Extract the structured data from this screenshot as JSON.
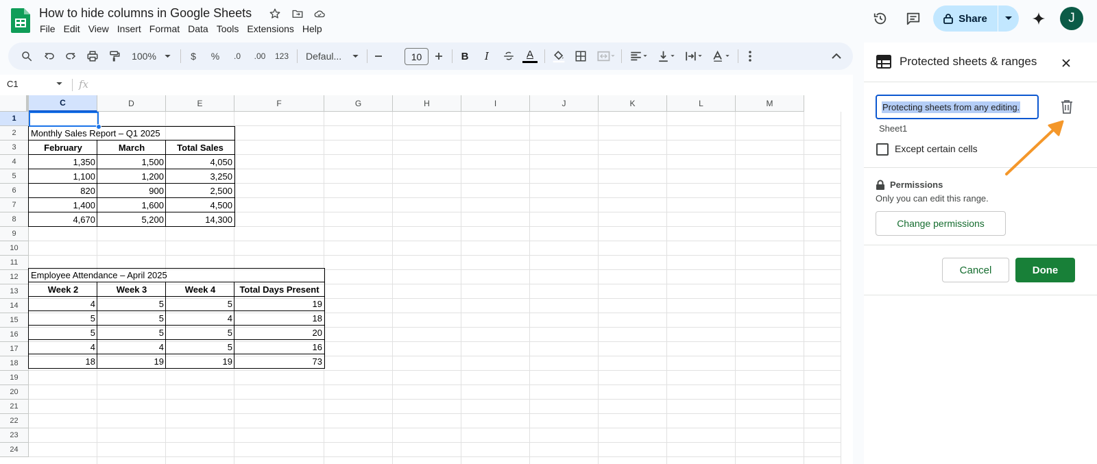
{
  "app": {
    "doc_title": "How to hide columns in Google Sheets",
    "menu": [
      "File",
      "Edit",
      "View",
      "Insert",
      "Format",
      "Data",
      "Tools",
      "Extensions",
      "Help"
    ],
    "share_label": "Share",
    "avatar_initial": "J",
    "accent_color": "#0b57d0",
    "share_bg": "#c2e7ff"
  },
  "toolbar": {
    "zoom": "100%",
    "currency": "$",
    "percent": "%",
    "dec_decrease": ".0",
    "dec_increase": ".00",
    "number_format": "123",
    "font": "Defaul...",
    "font_size": "10",
    "bold": "B",
    "italic": "I",
    "text_color_letter": "A"
  },
  "formula_bar": {
    "name_box": "C1",
    "fx": "fx"
  },
  "grid": {
    "columns": [
      "C",
      "D",
      "E",
      "F",
      "G",
      "H",
      "I",
      "J",
      "K",
      "L",
      "M"
    ],
    "rows": [
      "1",
      "2",
      "3",
      "4",
      "5",
      "6",
      "7",
      "8",
      "9",
      "10",
      "11",
      "12",
      "13",
      "14",
      "15",
      "16",
      "17",
      "18",
      "19",
      "20",
      "21",
      "22",
      "23",
      "24"
    ],
    "selected_column": "C",
    "selected_row": "1"
  },
  "sales_table": {
    "title": "Monthly Sales Report – Q1 2025",
    "headers": [
      "February",
      "March",
      "Total Sales"
    ],
    "rows": [
      [
        "1,350",
        "1,500",
        "4,050"
      ],
      [
        "1,100",
        "1,200",
        "3,250"
      ],
      [
        "820",
        "900",
        "2,500"
      ],
      [
        "1,400",
        "1,600",
        "4,500"
      ],
      [
        "4,670",
        "5,200",
        "14,300"
      ]
    ]
  },
  "attendance_table": {
    "title": "Employee Attendance – April 2025",
    "headers": [
      "Week 2",
      "Week 3",
      "Week 4",
      "Total Days Present"
    ],
    "rows": [
      [
        "4",
        "5",
        "5",
        "19"
      ],
      [
        "5",
        "5",
        "4",
        "18"
      ],
      [
        "5",
        "5",
        "5",
        "20"
      ],
      [
        "4",
        "4",
        "5",
        "16"
      ],
      [
        "18",
        "19",
        "19",
        "73"
      ]
    ]
  },
  "panel": {
    "title": "Protected sheets & ranges",
    "description_value": "Protecting sheets from any editing.",
    "sheet_name": "Sheet1",
    "except_label": "Except certain cells",
    "permissions_title": "Permissions",
    "permissions_desc": "Only you can edit this range.",
    "change_permissions": "Change permissions",
    "cancel": "Cancel",
    "done": "Done",
    "annotation_color": "#f4972a"
  }
}
